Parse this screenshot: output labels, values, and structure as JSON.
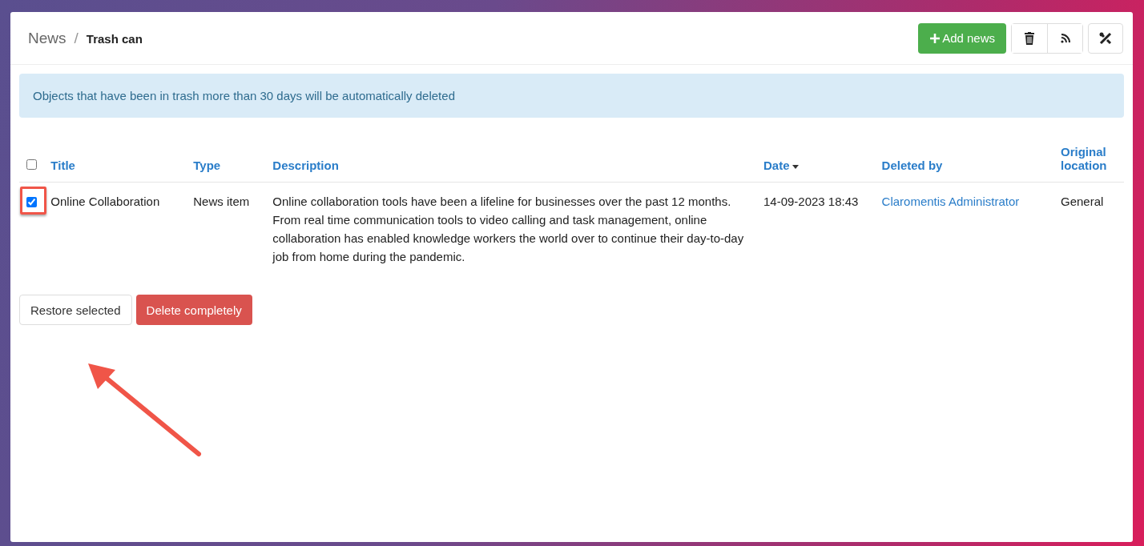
{
  "breadcrumb": {
    "parent": "News",
    "separator": "/",
    "current": "Trash can"
  },
  "toolbar": {
    "add_button": "Add news",
    "icon_buttons": [
      {
        "kind": "trash"
      },
      {
        "kind": "feed"
      }
    ],
    "tools_button": {
      "kind": "tools"
    }
  },
  "alert": "Objects that have been in trash more than 30 days will be automatically deleted",
  "table": {
    "select_all_checked": false,
    "columns": [
      {
        "label": "Title",
        "sorted": false
      },
      {
        "label": "Type",
        "sorted": false
      },
      {
        "label": "Description",
        "sorted": false
      },
      {
        "label": "Date",
        "sorted": true
      },
      {
        "label": "Deleted by",
        "sorted": false
      },
      {
        "label": "Original location",
        "sorted": false
      }
    ],
    "rows": [
      {
        "checked": true,
        "highlighted": true,
        "title": "Online Collaboration",
        "type": "News item",
        "description": "Online collaboration tools have been a lifeline for businesses over the past 12 months. From real time communication tools to video calling and task management, online collaboration has enabled knowledge workers the world over to continue their day-to-day job from home during the pandemic.",
        "date": "14-09-2023 18:43",
        "deleted_by": "Claromentis Administrator",
        "location": "General"
      }
    ]
  },
  "actions": {
    "restore": "Restore selected",
    "delete": "Delete completely"
  },
  "annotation": {
    "arrow": true
  }
}
